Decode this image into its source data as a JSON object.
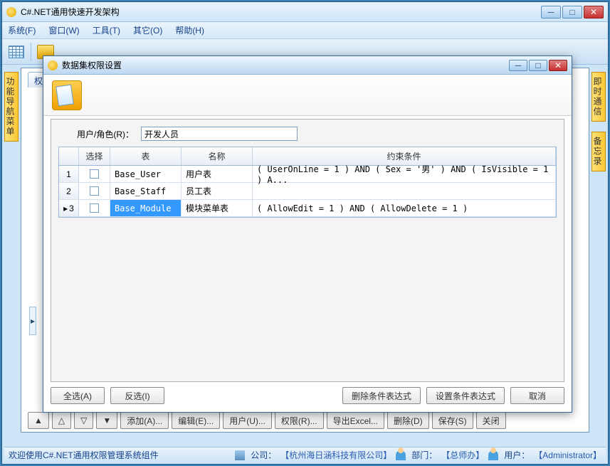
{
  "main": {
    "title": "C#.NET通用快速开发架构",
    "menu": [
      "系统(F)",
      "窗口(W)",
      "工具(T)",
      "其它(O)",
      "帮助(H)"
    ]
  },
  "sideTabs": {
    "left": "功能导航菜单",
    "right1": "即时通信",
    "right2": "备忘录"
  },
  "innerTab": "权...",
  "bottomButtons": {
    "add": "添加(A)...",
    "edit": "编辑(E)...",
    "user": "用户(U)...",
    "perm": "权限(R)...",
    "export": "导出Excel...",
    "delete": "删除(D)",
    "save": "保存(S)",
    "close": "关闭"
  },
  "status": {
    "welcome": "欢迎使用C#.NET通用权限管理系统组件",
    "companyLabel": "公司：",
    "company": "【杭州海日涵科技有限公司】",
    "deptLabel": "部门：",
    "dept": "【总师办】",
    "userLabel": "用户：",
    "user": "【Administrator】"
  },
  "dialog": {
    "title": "数据集权限设置",
    "roleLabel": "用户/角色(R)：",
    "roleValue": "开发人员",
    "headers": {
      "select": "选择",
      "table": "表",
      "name": "名称",
      "condition": "约束条件"
    },
    "rows": [
      {
        "n": "1",
        "table": "Base_User",
        "name": "用户表",
        "cond": "( UserOnLine = 1 ) AND ( Sex = '男' ) AND ( IsVisible = 1 ) A..."
      },
      {
        "n": "2",
        "table": "Base_Staff",
        "name": "员工表",
        "cond": ""
      },
      {
        "n": "3",
        "table": "Base_Module",
        "name": "模块菜单表",
        "cond": "( AllowEdit = 1 ) AND ( AllowDelete = 1 )"
      }
    ],
    "footer": {
      "selectAll": "全选(A)",
      "invert": "反选(I)",
      "delCond": "删除条件表达式",
      "setCond": "设置条件表达式",
      "cancel": "取消"
    }
  }
}
